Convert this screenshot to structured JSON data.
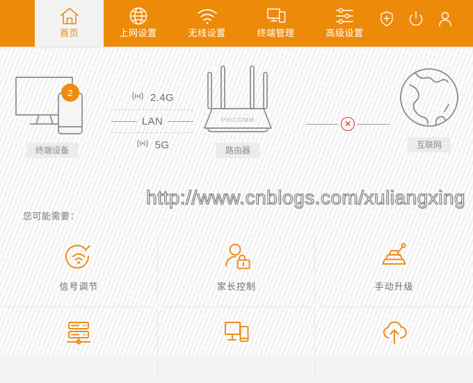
{
  "theme": {
    "accent": "#ee8a0a",
    "accent_icon": "#ed8a0a",
    "page_bg": "#f5f5f5",
    "label_bg": "#ececec",
    "label_text": "#8c8c8c",
    "line_gray": "#9a9a9a",
    "error_red": "#e2322a",
    "divider": "#f6e3cc"
  },
  "nav": {
    "items": [
      {
        "label": "首页",
        "icon": "home-icon",
        "active": true
      },
      {
        "label": "上网设置",
        "icon": "globe-icon",
        "active": false
      },
      {
        "label": "无线设置",
        "icon": "wifi-icon",
        "active": false
      },
      {
        "label": "终端管理",
        "icon": "devices-icon",
        "active": false
      },
      {
        "label": "高级设置",
        "icon": "sliders-icon",
        "active": false
      }
    ],
    "right_icons": [
      {
        "name": "shield-plus-icon"
      },
      {
        "name": "power-icon"
      },
      {
        "name": "user-icon"
      }
    ]
  },
  "topology": {
    "devices": {
      "label": "终端设备",
      "badge_count": "2",
      "icon": "monitor-phone-icon"
    },
    "router": {
      "label": "路由器",
      "brand": "PHICOMM",
      "icon": "router-icon"
    },
    "internet": {
      "label": "互联网",
      "icon": "globe-earth-icon"
    },
    "links": {
      "wifi24": {
        "label": "2.4G",
        "icon": "signal-icon",
        "style": "dotted"
      },
      "lan": {
        "label": "LAN",
        "style": "solid"
      },
      "wifi5": {
        "label": "5G",
        "icon": "signal-icon",
        "style": "dotted"
      },
      "wan": {
        "status_icon": "x-circle-icon",
        "connected": false
      }
    }
  },
  "watermark": {
    "text": "http://www.cnblogs.com/xuliangxing"
  },
  "shortcuts": {
    "title": "您可能需要：",
    "items": [
      {
        "label": "信号调节",
        "icon": "signal-tune-icon"
      },
      {
        "label": "家长控制",
        "icon": "parental-lock-icon"
      },
      {
        "label": "手动升级",
        "icon": "manual-upgrade-icon"
      },
      {
        "label": "",
        "icon": "bridge-server-icon"
      },
      {
        "label": "",
        "icon": "device-manage-icon"
      },
      {
        "label": "",
        "icon": "cloud-upload-icon"
      }
    ]
  }
}
